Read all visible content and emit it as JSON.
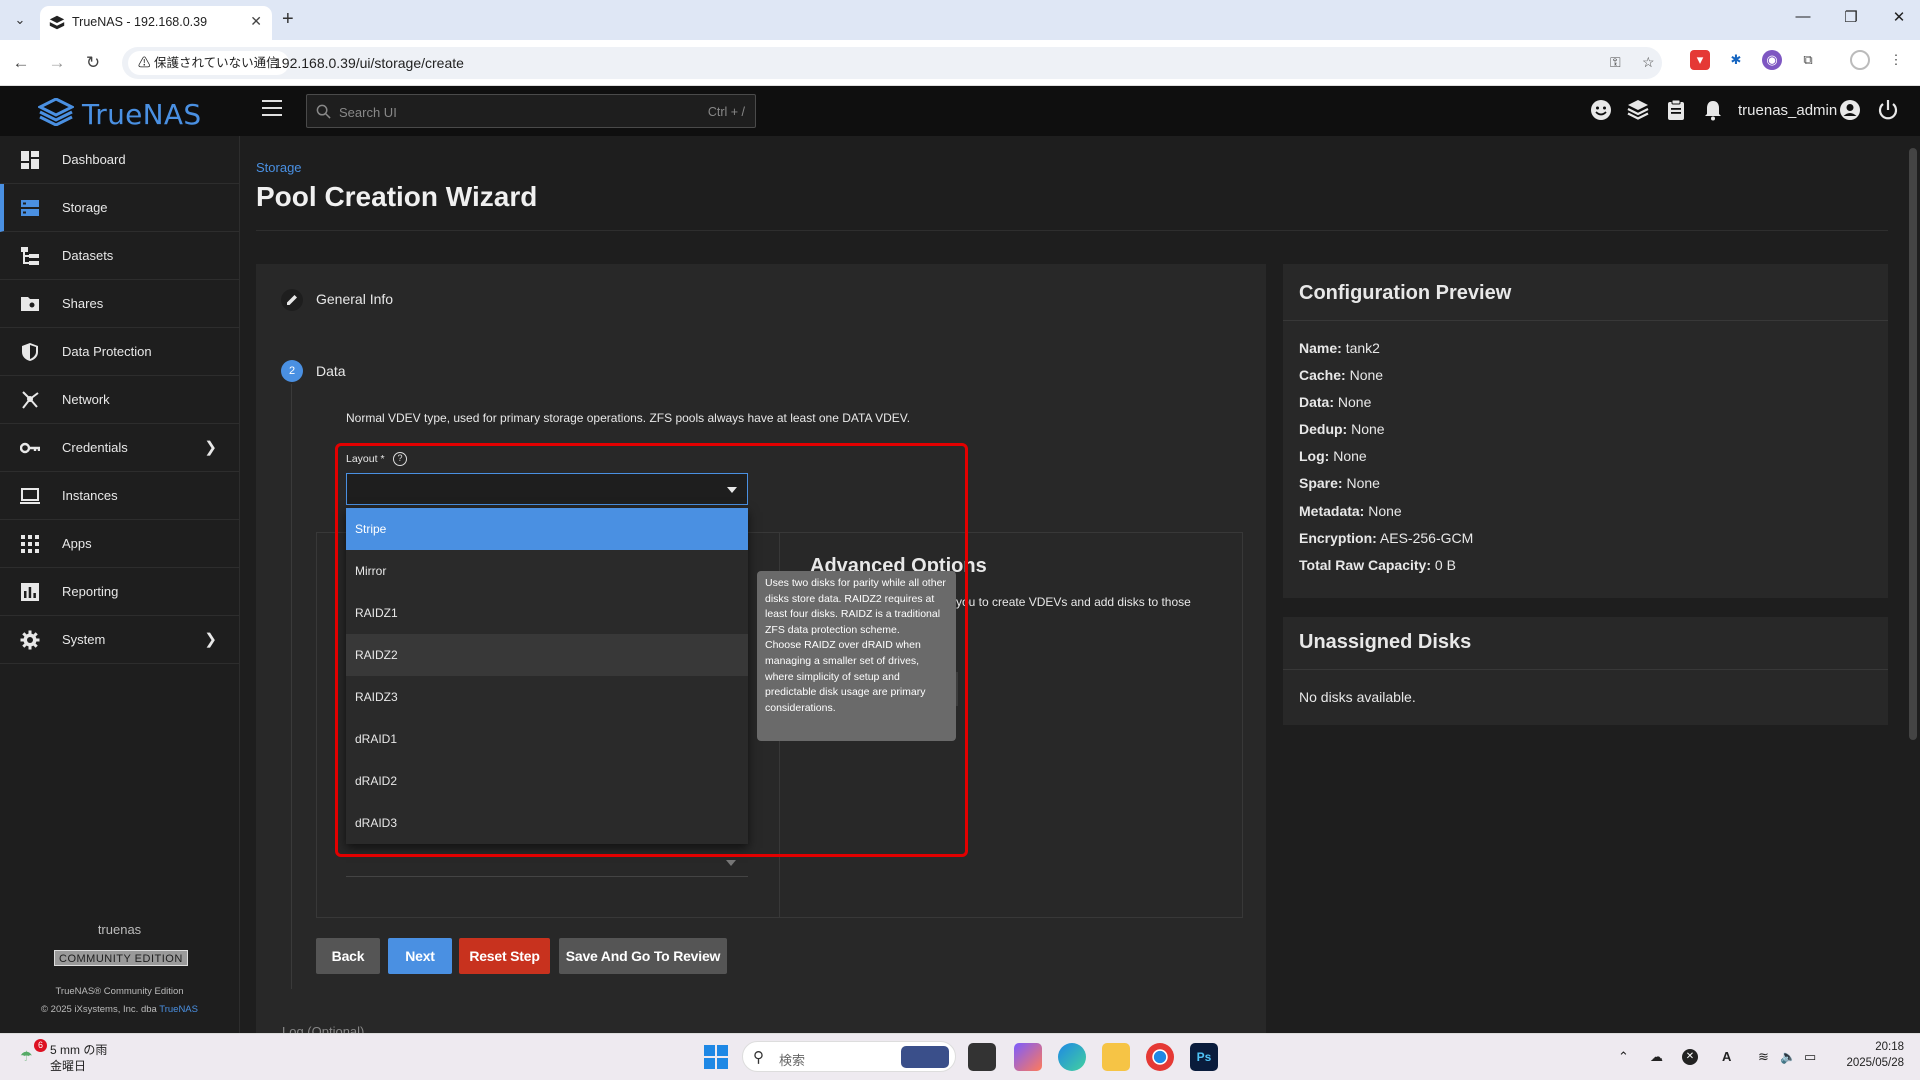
{
  "browser": {
    "tab_title": "TrueNAS - 192.168.0.39",
    "security_chip": "保護されていない通信",
    "url": "192.168.0.39/ui/storage/create"
  },
  "header": {
    "brand": "TrueNAS",
    "search_placeholder": "Search UI",
    "search_shortcut": "Ctrl + /",
    "username": "truenas_admin"
  },
  "sidebar": {
    "items": [
      {
        "label": "Dashboard",
        "icon": "dashboard-icon"
      },
      {
        "label": "Storage",
        "icon": "storage-icon"
      },
      {
        "label": "Datasets",
        "icon": "datasets-icon"
      },
      {
        "label": "Shares",
        "icon": "shares-icon"
      },
      {
        "label": "Data Protection",
        "icon": "shield-icon"
      },
      {
        "label": "Network",
        "icon": "network-icon"
      },
      {
        "label": "Credentials",
        "icon": "key-icon"
      },
      {
        "label": "Instances",
        "icon": "laptop-icon"
      },
      {
        "label": "Apps",
        "icon": "apps-grid-icon"
      },
      {
        "label": "Reporting",
        "icon": "chart-icon"
      },
      {
        "label": "System",
        "icon": "gear-icon"
      }
    ],
    "hostname": "truenas",
    "edition": "COMMUNITY EDITION",
    "copyright_line1": "TrueNAS® Community Edition",
    "copyright_line2_prefix": "© 2025 iXsystems, Inc. dba",
    "copyright_line2_link": "TrueNAS"
  },
  "page": {
    "breadcrumb": "Storage",
    "title": "Pool Creation Wizard"
  },
  "wizard": {
    "step1_label": "General Info",
    "step2_number": "2",
    "step2_label": "Data",
    "step_description": "Normal VDEV type, used for primary storage operations. ZFS pools always have at least one DATA VDEV.",
    "layout_label": "Layout *",
    "layout_help": "?",
    "layout_options": [
      "Stripe",
      "Mirror",
      "RAIDZ1",
      "RAIDZ2",
      "RAIDZ3",
      "dRAID1",
      "dRAID2",
      "dRAID3"
    ],
    "layout_selected": "Stripe",
    "layout_hovered": "RAIDZ2",
    "tooltip": "Uses two disks for parity while all other disks store data. RAIDZ2 requires at least four disks. RAIDZ is a traditional ZFS data protection scheme.\nChoose RAIDZ over dRAID when managing a smaller set of drives, where simplicity of setup and predictable disk usage are primary considerations.",
    "advanced_title": "Advanced Options",
    "advanced_desc": "ws you to create VDEVs and add disks to those",
    "buttons": {
      "back": "Back",
      "next": "Next",
      "reset": "Reset Step",
      "save_review": "Save And Go To Review"
    },
    "next_step_label": "Log (Optional)"
  },
  "config_preview": {
    "title": "Configuration Preview",
    "rows": [
      {
        "key": "Name:",
        "value": "tank2"
      },
      {
        "key": "Cache:",
        "value": "None"
      },
      {
        "key": "Data:",
        "value": "None"
      },
      {
        "key": "Dedup:",
        "value": "None"
      },
      {
        "key": "Log:",
        "value": "None"
      },
      {
        "key": "Spare:",
        "value": "None"
      },
      {
        "key": "Metadata:",
        "value": "None"
      },
      {
        "key": "Encryption:",
        "value": "AES-256-GCM"
      },
      {
        "key": "Total Raw Capacity:",
        "value": "0 B"
      }
    ]
  },
  "unassigned": {
    "title": "Unassigned Disks",
    "text": "No disks available."
  },
  "taskbar": {
    "weather_badge": "6",
    "weather_line1": "5 mm の雨",
    "weather_line2": "金曜日",
    "search_text": "検索",
    "time": "20:18",
    "date": "2025/05/28"
  },
  "colors": {
    "accent": "#4a90e2",
    "danger": "#c8321e",
    "highlight": "#e30000"
  }
}
